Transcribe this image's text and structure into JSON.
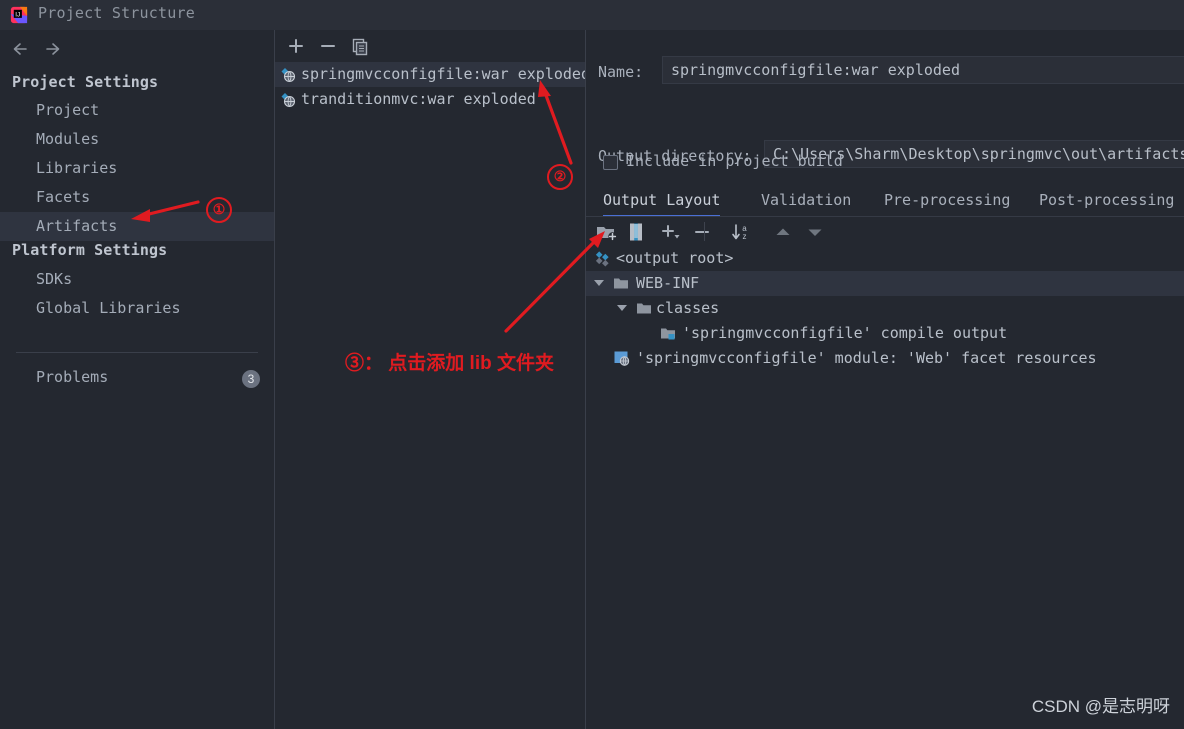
{
  "window": {
    "title": "Project Structure",
    "logo_icon": "intellij-idea-logo"
  },
  "sidebar": {
    "nav": {
      "back_icon": "arrow-left-icon",
      "forward_icon": "arrow-right-icon"
    },
    "sections": [
      {
        "header": "Project Settings",
        "items": [
          {
            "label": "Project",
            "selected": false
          },
          {
            "label": "Modules",
            "selected": false
          },
          {
            "label": "Libraries",
            "selected": false
          },
          {
            "label": "Facets",
            "selected": false
          },
          {
            "label": "Artifacts",
            "selected": true
          }
        ]
      },
      {
        "header": "Platform Settings",
        "items": [
          {
            "label": "SDKs",
            "selected": false
          },
          {
            "label": "Global Libraries",
            "selected": false
          }
        ]
      }
    ],
    "problems": {
      "label": "Problems",
      "count": "3"
    }
  },
  "artifacts_panel": {
    "toolbar": [
      {
        "name": "add-artifact-button",
        "icon": "plus-icon",
        "glyph": "+"
      },
      {
        "name": "remove-artifact-button",
        "icon": "minus-icon",
        "glyph": "−"
      },
      {
        "name": "copy-artifact-button",
        "icon": "copy-icon",
        "glyph": "copy"
      }
    ],
    "items": [
      {
        "label": "springmvcconfigfile:war exploded",
        "icon": "artifact-icon",
        "selected": true
      },
      {
        "label": "tranditionmvc:war exploded",
        "icon": "artifact-icon",
        "selected": false
      }
    ]
  },
  "details": {
    "name_label": "Name:",
    "name_value": "springmvcconfigfile:war exploded",
    "output_dir_label": "Output directory:",
    "output_dir_value": "C:\\Users\\Sharm\\Desktop\\springmvc\\out\\artifacts",
    "include_in_build_label": "Include in project build",
    "include_in_build_checked": false,
    "tabs": [
      {
        "label": "Output Layout",
        "active": true
      },
      {
        "label": "Validation",
        "active": false
      },
      {
        "label": "Pre-processing",
        "active": false
      },
      {
        "label": "Post-processing",
        "active": false
      }
    ],
    "layout_toolbar": [
      {
        "name": "create-directory-button",
        "icon": "folder-add-icon"
      },
      {
        "name": "create-archive-button",
        "icon": "archive-icon"
      },
      {
        "name": "add-copy-of-button",
        "icon": "plus-dropdown-icon"
      },
      {
        "name": "remove-element-button",
        "icon": "minus-icon"
      },
      {
        "name": "sort-button",
        "icon": "sort-az-icon"
      },
      {
        "name": "move-up-button",
        "icon": "arrow-up-icon"
      },
      {
        "name": "move-down-button",
        "icon": "arrow-down-icon"
      }
    ],
    "tree": [
      {
        "label": "<output root>",
        "icon": "artifact-icon",
        "depth": 0,
        "twisty": false,
        "selected": false
      },
      {
        "label": "WEB-INF",
        "icon": "folder-icon",
        "depth": 0,
        "twisty": true,
        "selected": true
      },
      {
        "label": "classes",
        "icon": "folder-icon",
        "depth": 1,
        "twisty": true,
        "selected": false
      },
      {
        "label": "'springmvcconfigfile' compile output",
        "icon": "compile-output-icon",
        "depth": 3,
        "twisty": false,
        "selected": false
      },
      {
        "label": "'springmvcconfigfile' module: 'Web' facet resources",
        "icon": "web-facet-icon",
        "depth": 1,
        "twisty": false,
        "selected": false
      }
    ]
  },
  "annotations": {
    "marker1": "①",
    "marker2": "②",
    "marker3": "③",
    "note_text": "③： 点击添加 lib 文件夹",
    "arrow_color": "#e01b20"
  },
  "watermark": "CSDN @是志明呀",
  "colors": {
    "background": "#242830",
    "titlebar": "#2b2f38",
    "selection": "#2f3440",
    "accent": "#4a6fd4",
    "artifact_cyan": "#3592c4",
    "annotation_red": "#e01b20"
  }
}
